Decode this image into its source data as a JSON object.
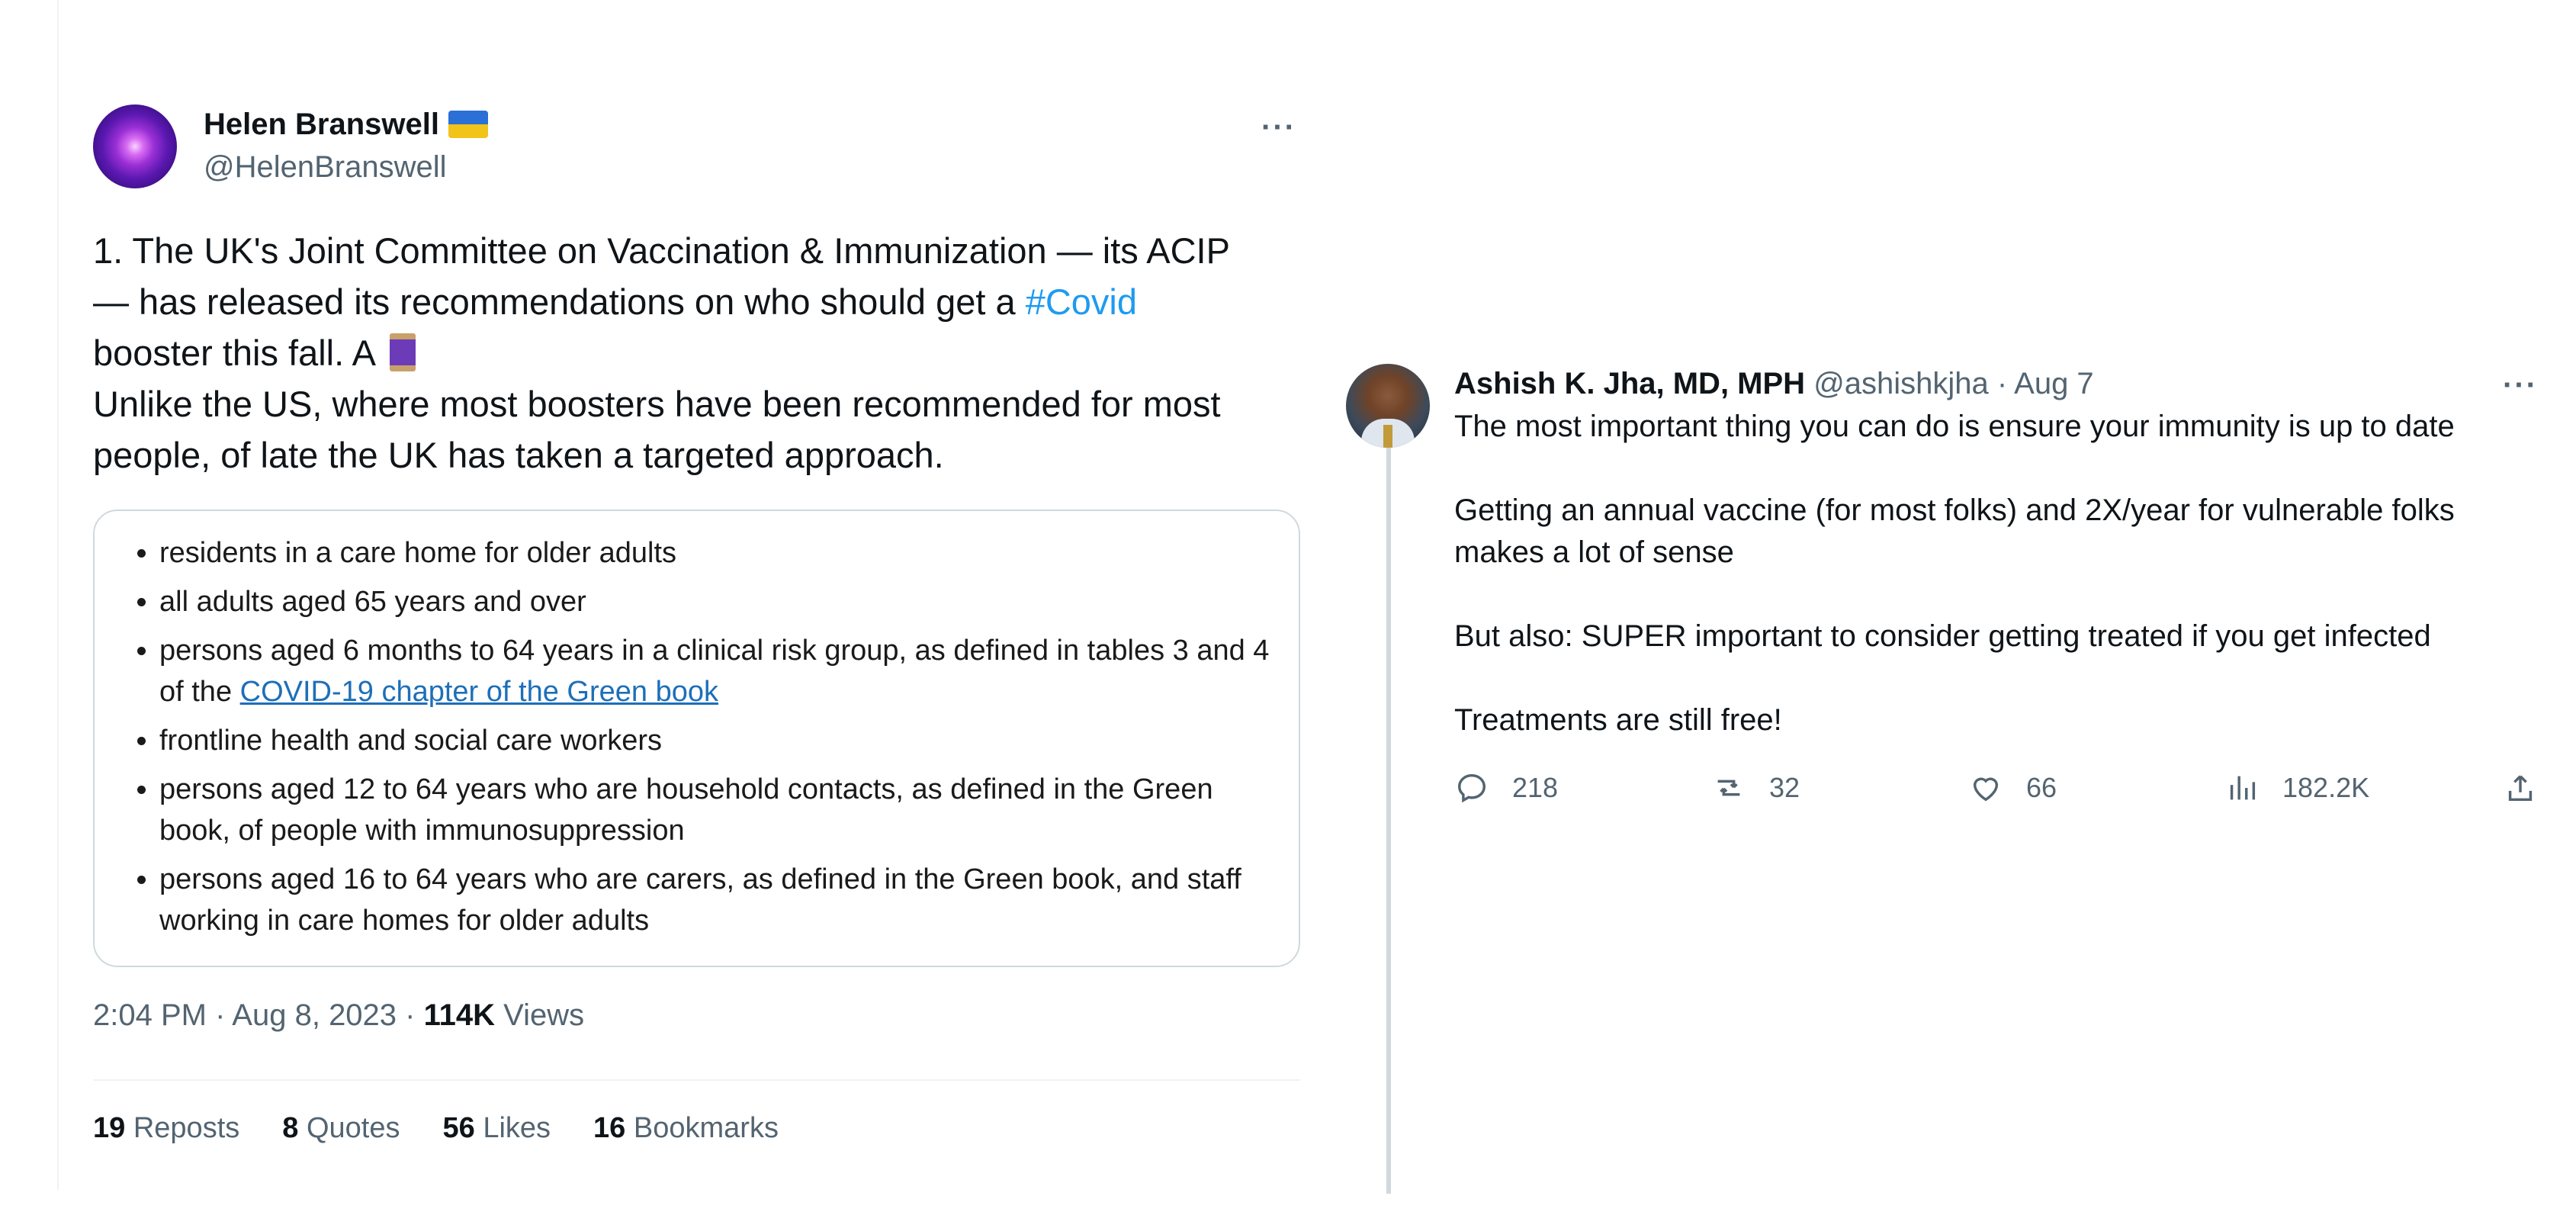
{
  "tweet1": {
    "display_name": "Helen Branswell",
    "handle": "@HelenBranswell",
    "more": "···",
    "text_line1": "1. The UK's Joint Committee on Vaccination & Immunization — its ACIP",
    "text_line2_pre": "— has released its recommendations on who should get a ",
    "hashtag": "#Covid",
    "text_line3": "booster this fall. A ",
    "text_line4": "Unlike the US, where most boosters have been recommended for most",
    "text_line5": "people, of late the UK has taken a targeted approach.",
    "card": {
      "items": [
        "residents in a care home for older adults",
        "all adults aged 65 years and over",
        "persons aged 6 months to 64 years in a clinical risk group, as defined in tables 3 and 4 of the ",
        "frontline health and social care workers",
        "persons aged 12 to 64 years who are household contacts, as defined in the Green book, of people with immunosuppression",
        "persons aged 16 to 64 years who are carers, as defined in the Green book, and staff working in care homes for older adults"
      ],
      "link_text": "COVID-19 chapter of the Green book"
    },
    "time": "2:04 PM · Aug 8, 2023 · ",
    "views_count": "114K",
    "views_label": " Views",
    "stats": {
      "reposts_count": "19",
      "reposts_label": "Reposts",
      "quotes_count": "8",
      "quotes_label": "Quotes",
      "likes_count": "56",
      "likes_label": "Likes",
      "bookmarks_count": "16",
      "bookmarks_label": "Bookmarks"
    }
  },
  "tweet2": {
    "display_name": "Ashish K. Jha, MD, MPH",
    "handle_date": "@ashishkjha · Aug 7",
    "more": "···",
    "paragraphs": [
      "The most important thing you can do is ensure your immunity is up to date",
      "Getting an annual vaccine (for most folks) and 2X/year for vulnerable folks makes a lot of sense",
      "But also:  SUPER important to consider getting treated if you get infected",
      "Treatments are still free!"
    ],
    "actions": {
      "replies": "218",
      "reposts": "32",
      "likes": "66",
      "views": "182.2K"
    }
  },
  "colors": {
    "link": "#1d9bf0",
    "secondary_text": "#536471",
    "border": "#cfd9de"
  }
}
